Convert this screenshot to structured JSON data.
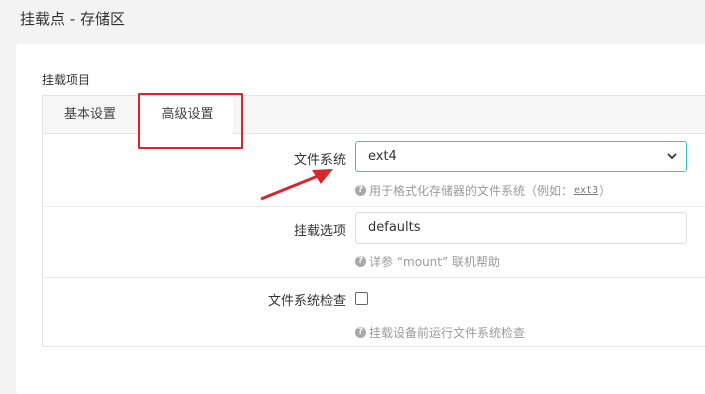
{
  "page": {
    "title": "挂载点 - 存储区"
  },
  "section": {
    "title": "挂载项目"
  },
  "tabs": [
    {
      "label": "基本设置"
    },
    {
      "label": "高级设置"
    }
  ],
  "fields": {
    "filesystem": {
      "label": "文件系统",
      "value": "ext4",
      "help_prefix": "用于格式化存储器的文件系统（例如：",
      "help_code": "ext3",
      "help_suffix": "）"
    },
    "options": {
      "label": "挂载选项",
      "value": "defaults",
      "help": "详参 “mount” 联机帮助"
    },
    "fscheck": {
      "label": "文件系统检查",
      "checked": false,
      "help": "挂载设备前运行文件系统检查"
    }
  },
  "colors": {
    "annotation": "#d9262a",
    "focus_border": "#34c3c9",
    "page_bg": "#f3f3f3"
  },
  "icons": {
    "help": "question-circle-icon",
    "select": "chevron-down-icon",
    "annotation": "red-arrow"
  }
}
